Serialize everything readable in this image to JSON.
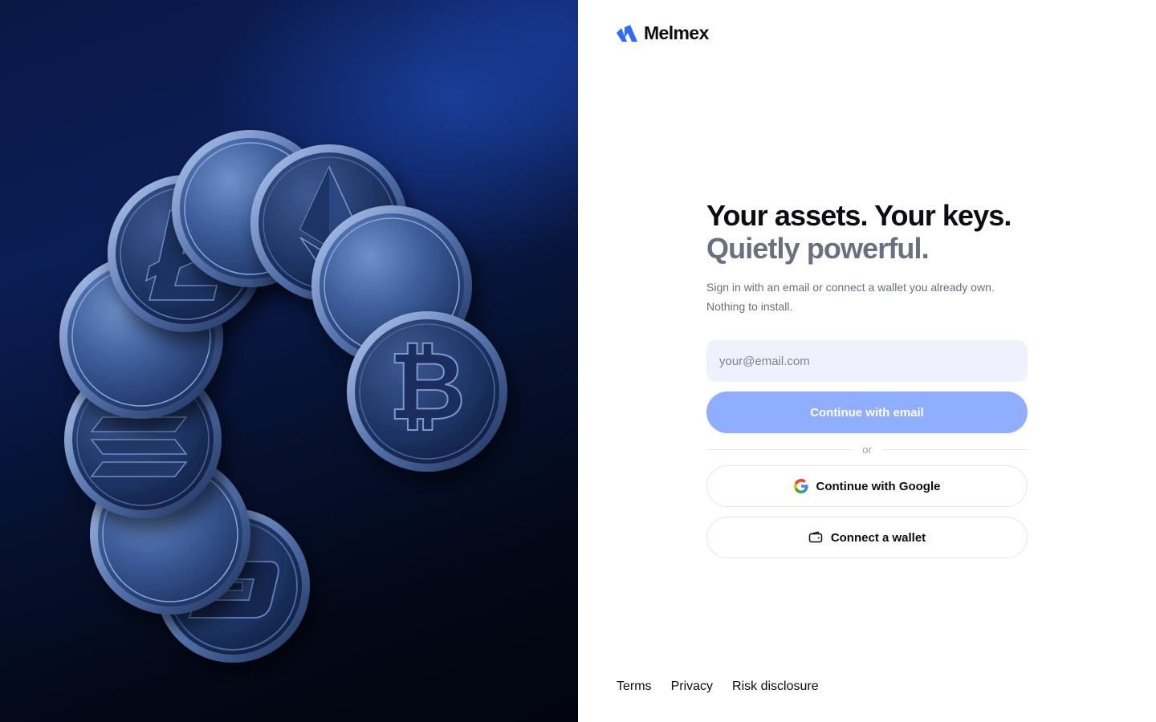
{
  "brand": {
    "name": "Melmex",
    "logo_icon": "melmex-logo-icon",
    "accent": "#2f6bff"
  },
  "hero": {
    "image": "crypto-coins-illustration",
    "coins": [
      "bitcoin",
      "ethereum",
      "litecoin",
      "solana",
      "dash",
      "blank",
      "blank"
    ]
  },
  "main": {
    "headline": "Your assets. Your keys.",
    "subheadline": "Quietly powerful.",
    "description": "Sign in with an email or connect a wallet you already own. Nothing to install.",
    "email": {
      "placeholder": "your@email.com",
      "value": ""
    },
    "continue_email_label": "Continue with email",
    "divider_label": "or",
    "google_label": "Continue with Google",
    "google_icon": "google-icon",
    "wallet_label": "Connect a wallet",
    "wallet_icon": "wallet-icon"
  },
  "footer": {
    "links": [
      "Terms",
      "Privacy",
      "Risk disclosure"
    ]
  },
  "colors": {
    "primary_button": "#8faeff",
    "input_bg": "#eff2fd",
    "muted_text": "#6b7080"
  }
}
